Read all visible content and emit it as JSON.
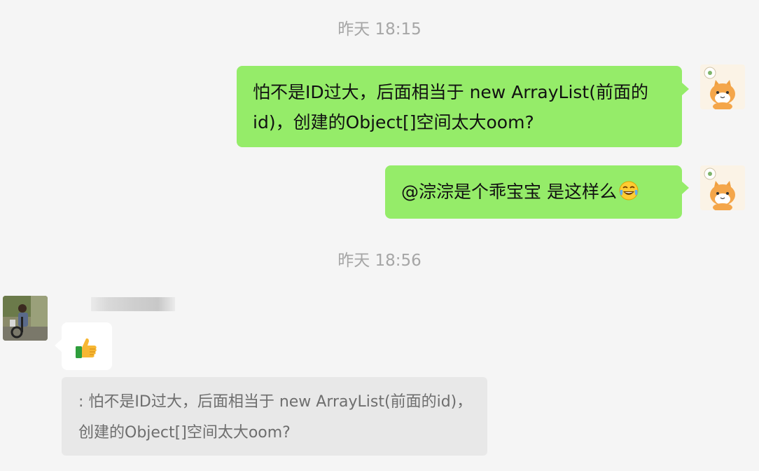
{
  "timestamps": [
    "昨天 18:15",
    "昨天 18:56"
  ],
  "messages": [
    {
      "sender": "self",
      "text": "怕不是ID过大，后面相当于 new ArrayList(前面的id)，创建的Object[]空间太大oom?"
    },
    {
      "sender": "self",
      "text": "@淙淙是个乖宝宝 是这样么",
      "emoji": "face-with-tears-of-joy-icon"
    },
    {
      "sender": "other",
      "emoji": "thumbs-up-icon",
      "quote": ": 怕不是ID过大，后面相当于 new ArrayList(前面的id)，创建的Object[]空间太大oom?"
    }
  ],
  "colors": {
    "background": "#f5f5f5",
    "self_bubble": "#95ec69",
    "other_bubble": "#ffffff",
    "quote_bg": "#e8e8e8",
    "timestamp_text": "#a6a6a6",
    "quote_text": "#6e6e6e"
  }
}
